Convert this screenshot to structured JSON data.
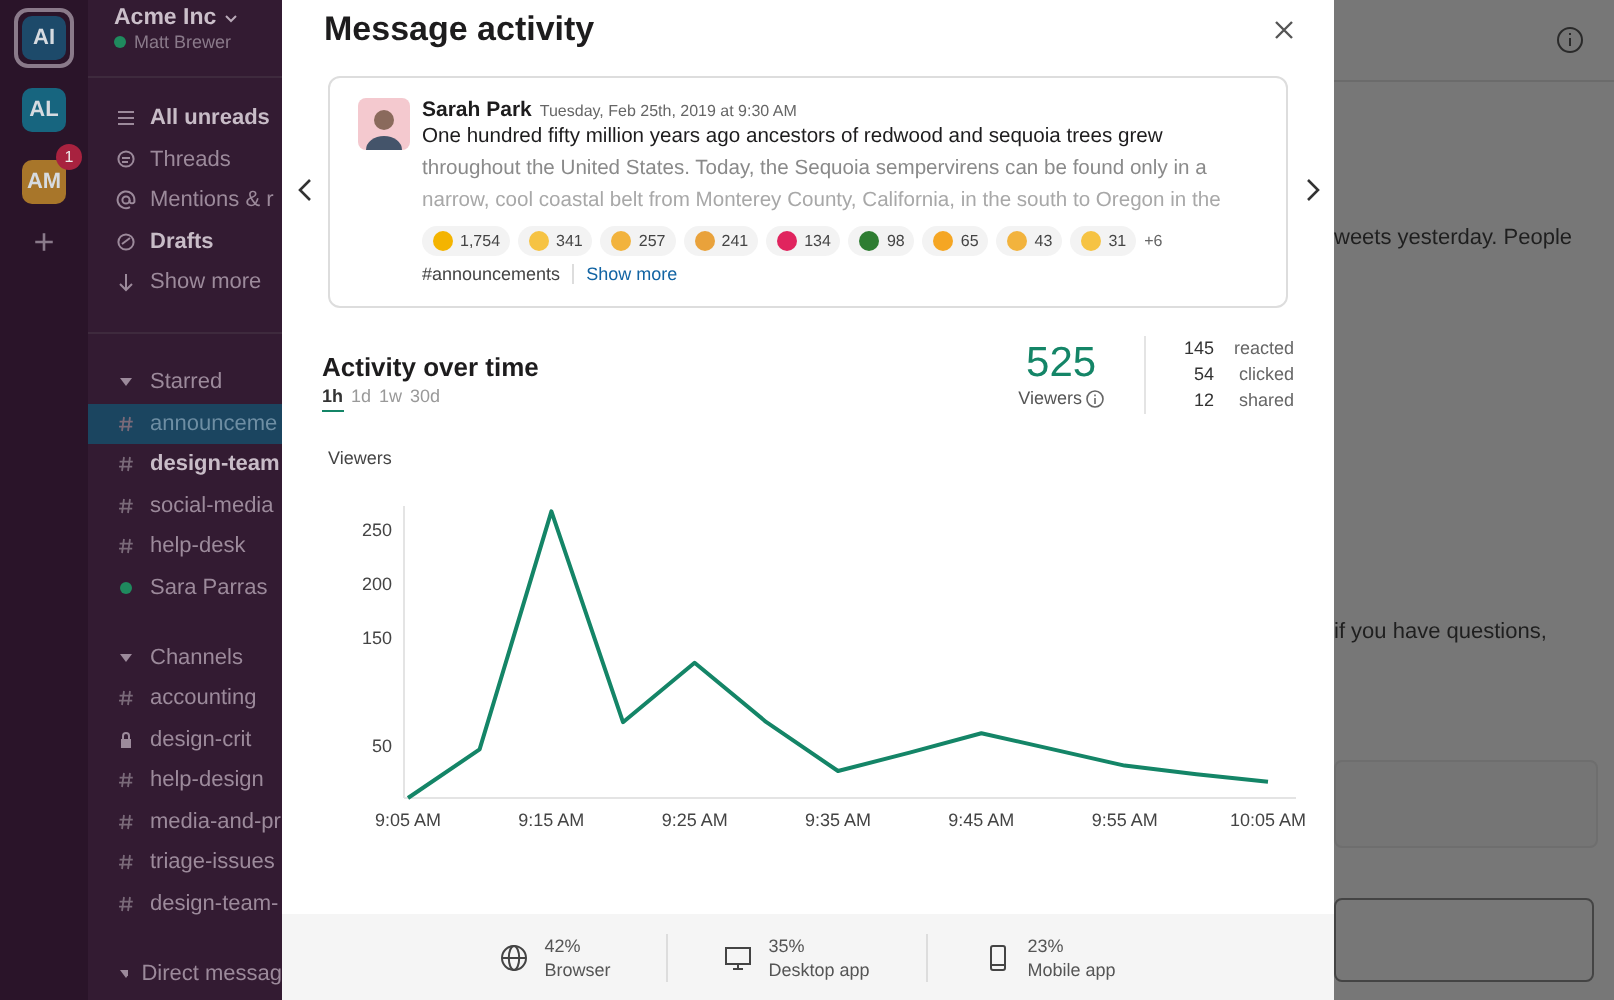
{
  "workspaces": [
    {
      "initials": "AI",
      "selected": true
    },
    {
      "initials": "AL",
      "selected": false
    },
    {
      "initials": "AM",
      "selected": false,
      "badge": "1"
    }
  ],
  "workspace_add": "+",
  "sidebar": {
    "team": "Acme Inc",
    "user": "Matt Brewer",
    "nav": [
      {
        "label": "All unreads",
        "kind": "unreads",
        "bold": true
      },
      {
        "label": "Threads",
        "kind": "threads",
        "bold": false
      },
      {
        "label": "Mentions & r",
        "kind": "mentions",
        "bold": false
      },
      {
        "label": "Drafts",
        "kind": "drafts",
        "bold": true
      },
      {
        "label": "Show more",
        "kind": "more",
        "bold": false
      }
    ],
    "sections": [
      {
        "title": "Starred",
        "items": [
          {
            "label": "announceme",
            "kind": "channel",
            "selected": true,
            "bold": false
          },
          {
            "label": "design-team",
            "kind": "channel",
            "selected": false,
            "bold": true
          },
          {
            "label": "social-media",
            "kind": "channel",
            "selected": false,
            "bold": false
          },
          {
            "label": "help-desk",
            "kind": "channel",
            "selected": false,
            "bold": false
          },
          {
            "label": "Sara Parras",
            "kind": "person",
            "selected": false,
            "bold": false
          }
        ]
      },
      {
        "title": "Channels",
        "items": [
          {
            "label": "accounting",
            "kind": "channel",
            "selected": false,
            "bold": false
          },
          {
            "label": "design-crit",
            "kind": "private",
            "selected": false,
            "bold": false
          },
          {
            "label": "help-design",
            "kind": "channel",
            "selected": false,
            "bold": false
          },
          {
            "label": "media-and-pr",
            "kind": "channel",
            "selected": false,
            "bold": false
          },
          {
            "label": "triage-issues",
            "kind": "channel",
            "selected": false,
            "bold": false
          },
          {
            "label": "design-team-",
            "kind": "channel",
            "selected": false,
            "bold": false
          }
        ]
      },
      {
        "title": "Direct messag"
      }
    ]
  },
  "background": {
    "lines": [
      "weets yesterday. People",
      "if you have questions,"
    ]
  },
  "modal": {
    "title": "Message activity",
    "message": {
      "author": "Sarah Park",
      "time": "Tuesday, Feb 25th, 2019 at 9:30 AM",
      "lines": [
        "One hundred fifty million years ago ancestors of redwood and sequoia trees grew",
        "throughout the United States. Today, the Sequoia sempervirens can be found only in a",
        "narrow, cool coastal belt from Monterey County, California, in the south to Oregon in the"
      ],
      "reactions": [
        {
          "count": "1,754",
          "color": "#f4b400"
        },
        {
          "count": "341",
          "color": "#f6c343"
        },
        {
          "count": "257",
          "color": "#f2b33d"
        },
        {
          "count": "241",
          "color": "#e9a23b"
        },
        {
          "count": "134",
          "color": "#e0245e"
        },
        {
          "count": "98",
          "color": "#2e7d32"
        },
        {
          "count": "65",
          "color": "#f5a623"
        },
        {
          "count": "43",
          "color": "#f2b33d"
        },
        {
          "count": "31",
          "color": "#f6c343"
        }
      ],
      "more_reactions": "+6",
      "channel": "#announcements",
      "show_more": "Show more"
    },
    "activity": {
      "title": "Activity over time",
      "ranges": [
        {
          "label": "1h",
          "selected": true
        },
        {
          "label": "1d",
          "selected": false
        },
        {
          "label": "1w",
          "selected": false
        },
        {
          "label": "30d",
          "selected": false
        }
      ],
      "viewers_count": "525",
      "viewers_label": "Viewers",
      "stats": [
        {
          "count": "145",
          "label": "reacted"
        },
        {
          "count": "54",
          "label": "clicked"
        },
        {
          "count": "12",
          "label": "shared"
        }
      ],
      "chart_data": {
        "type": "line",
        "ylabel": "Viewers",
        "categories": [
          "9:05 AM",
          null,
          "9:15 AM",
          null,
          "9:25 AM",
          null,
          "9:35 AM",
          null,
          "9:45 AM",
          null,
          "9:55 AM",
          null,
          "10:05 AM"
        ],
        "series": [
          {
            "color": "#148567",
            "values": [
              0,
              45,
              265,
              70,
              125,
              70,
              25,
              42,
              60,
              45,
              30,
              22,
              15
            ]
          }
        ],
        "ylim": [
          0,
          270
        ],
        "yticks": [
          50,
          150,
          200,
          250
        ]
      }
    },
    "platforms": [
      {
        "kind": "browser",
        "share": "42%",
        "label": "Browser"
      },
      {
        "kind": "desktop",
        "share": "35%",
        "label": "Desktop app"
      },
      {
        "kind": "mobile",
        "share": "23%",
        "label": "Mobile app"
      }
    ]
  }
}
